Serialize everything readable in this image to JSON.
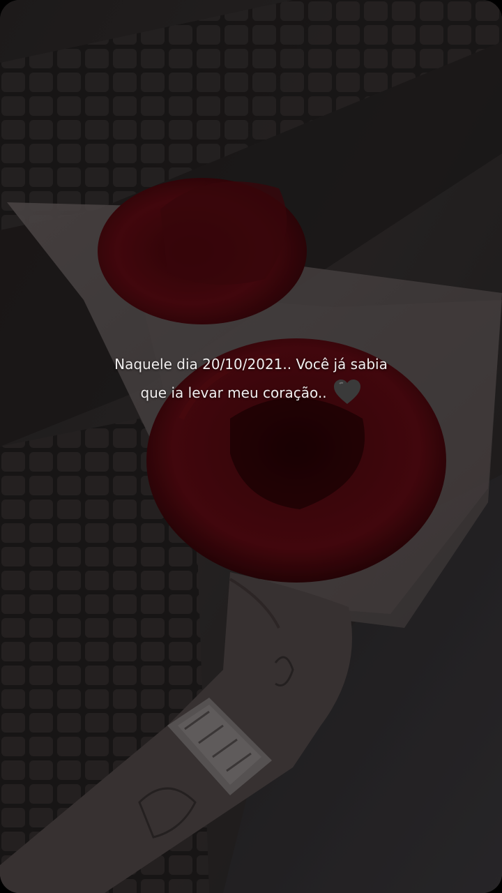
{
  "story": {
    "caption_line_1": "Naquele dia 20/10/2021.. Você já sabia",
    "caption_line_2": "que ia levar meu coração..",
    "emoji": "black-heart-icon"
  },
  "colors": {
    "rose": "#5a0a10",
    "paper": "#6e6464",
    "ground": "#2a2626",
    "text": "#f1efef",
    "heart": "#3a3a3a"
  }
}
